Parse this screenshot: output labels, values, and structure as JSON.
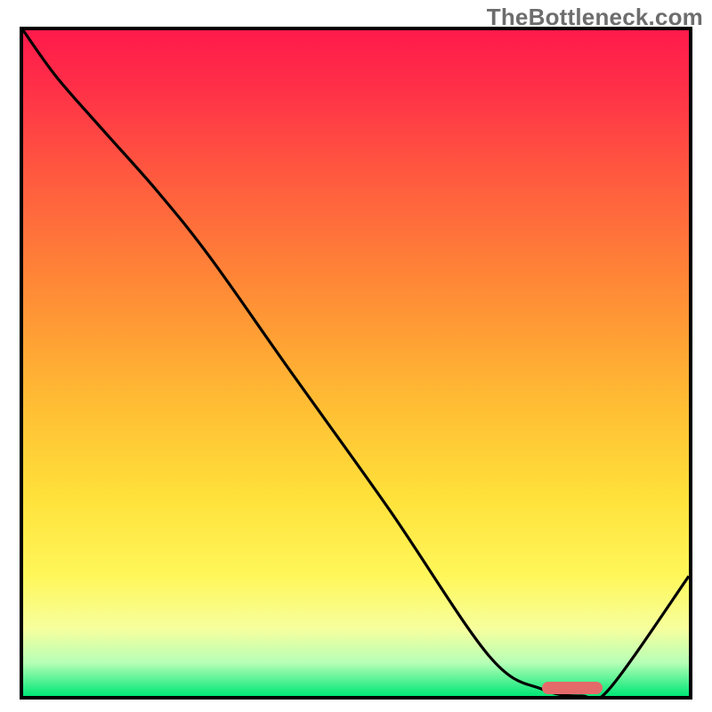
{
  "watermark": "TheBottleneck.com",
  "colors": {
    "stroke": "#000000",
    "marker": "#e46a6a"
  },
  "chart_data": {
    "type": "line",
    "title": "",
    "xlabel": "",
    "ylabel": "",
    "xlim": [
      0,
      100
    ],
    "ylim": [
      0,
      100
    ],
    "grid": false,
    "series": [
      {
        "name": "bottleneck-curve",
        "x": [
          0,
          5,
          12,
          20,
          28,
          40,
          55,
          70,
          78,
          84,
          88,
          100
        ],
        "y": [
          100,
          93,
          85,
          76,
          66,
          49,
          28,
          6,
          1,
          0,
          1,
          18
        ]
      }
    ],
    "marker_range_x": [
      78,
      87
    ]
  }
}
